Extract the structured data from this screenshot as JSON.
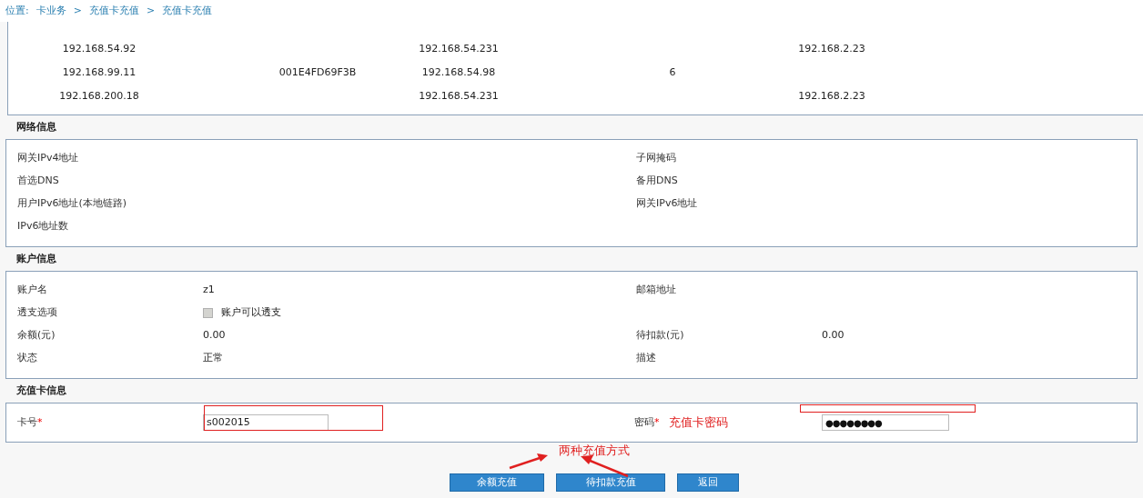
{
  "breadcrumb": {
    "prefix": "位置:",
    "items": [
      "卡业务",
      "充值卡充值",
      "充值卡充值"
    ],
    "separator": ">"
  },
  "ip_table": {
    "rows": [
      [
        "192.168.54.92",
        "",
        "192.168.54.231",
        "",
        "192.168.2.23"
      ],
      [
        "192.168.99.11",
        "001E4FD69F3B",
        "192.168.54.98",
        "6",
        ""
      ],
      [
        "192.168.200.18",
        "",
        "192.168.54.231",
        "",
        "192.168.2.23"
      ]
    ]
  },
  "network_info": {
    "title": "网络信息",
    "fields": [
      {
        "label": "网关IPv4地址"
      },
      {
        "label": "子网掩码"
      },
      {
        "label": "首选DNS"
      },
      {
        "label": "备用DNS"
      },
      {
        "label": "用户IPv6地址(本地链路)"
      },
      {
        "label": "网关IPv6地址"
      },
      {
        "label": "IPv6地址数"
      }
    ]
  },
  "account_info": {
    "title": "账户信息",
    "fields": [
      {
        "label": "账户名",
        "kind": "text",
        "value": "z1"
      },
      {
        "label": "邮箱地址",
        "kind": "text"
      },
      {
        "label": "透支选项",
        "kind": "checkbox",
        "value": "账户可以透支",
        "checked": false,
        "disabled": true
      },
      {
        "kind": "empty"
      },
      {
        "label": "余额(元)",
        "kind": "text",
        "value": "0.00"
      },
      {
        "label": "待扣款(元)",
        "kind": "text",
        "value": "0.00"
      },
      {
        "label": "状态",
        "kind": "text",
        "value": "正常"
      },
      {
        "label": "描述",
        "kind": "text"
      }
    ]
  },
  "card_info": {
    "title": "充值卡信息",
    "card_number": {
      "label": "卡号",
      "required_mark": "*",
      "value": "s002015"
    },
    "password": {
      "label": "密码",
      "required_mark": "*",
      "value": "●●●●●●●●"
    }
  },
  "annotations": {
    "password_note": "充值卡密码",
    "methods_note": "两种充值方式"
  },
  "buttons": [
    "余额充值",
    "待扣款充值",
    "返回"
  ]
}
